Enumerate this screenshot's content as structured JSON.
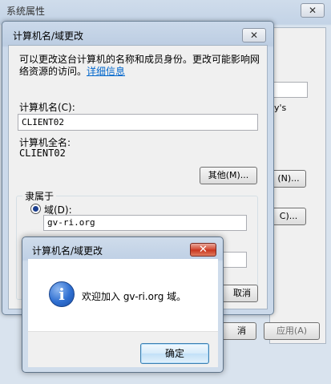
{
  "system_window": {
    "title": "系统属性",
    "close_glyph": "✕",
    "partial_text_1": "y's",
    "partial_button_1": "(N)...",
    "partial_button_2": "C)...",
    "partial_button_3": "消",
    "apply_button": "应用(A)"
  },
  "change_dialog": {
    "title": "计算机名/域更改",
    "close_glyph": "✕",
    "description": "可以更改这台计算机的名称和成员身份。更改可能影响网络资源的访问。",
    "details_link": "详细信息",
    "computer_name_label": "计算机名(C):",
    "computer_name_value": "CLIENT02",
    "full_name_label": "计算机全名:",
    "full_name_value": "CLIENT02",
    "other_button": "其他(M)...",
    "member_of_label": "隶属于",
    "domain_label": "域(D):",
    "domain_value": "gv-ri.org",
    "partial_button": "取消"
  },
  "message_box": {
    "title": "计算机名/域更改",
    "close_glyph": "✕",
    "icon": "info-icon",
    "icon_glyph": "i",
    "message": "欢迎加入 gv-ri.org 域。",
    "ok_button": "确定"
  }
}
